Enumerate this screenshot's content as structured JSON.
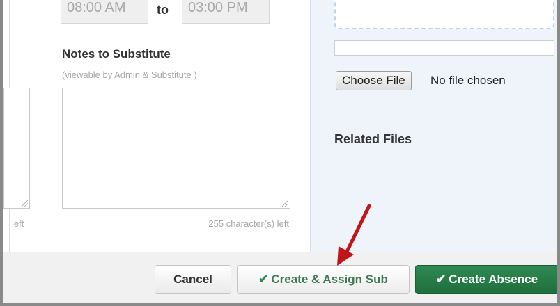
{
  "schedule": {
    "start_time": "08:00 AM",
    "to_label": "to",
    "end_time": "03:00 PM"
  },
  "notes": {
    "title": "Notes to Substitute",
    "subtitle": "(viewable by Admin & Substitute )",
    "value": "",
    "counter_left": "left",
    "counter_right": "255 character(s) left"
  },
  "files": {
    "choose_label": "Choose File",
    "no_file_text": "No file chosen",
    "related_title": "Related Files"
  },
  "footer": {
    "cancel_label": "Cancel",
    "assign_label": "Create & Assign Sub",
    "create_label": "Create Absence",
    "check_glyph": "✔"
  },
  "colors": {
    "primary_green": "#1f6e3d",
    "panel_blue": "#eef4fa",
    "annotation_arrow": "#c0151b"
  }
}
